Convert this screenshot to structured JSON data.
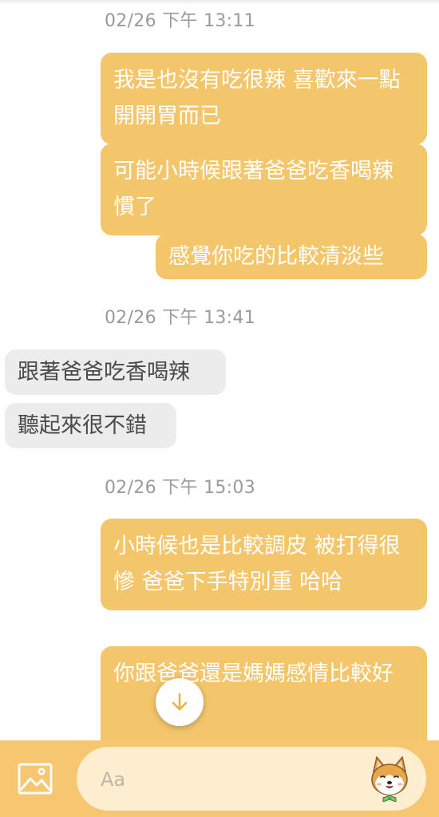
{
  "messages": [
    {
      "type": "timestamp",
      "text": "02/26 下午 13:11"
    },
    {
      "type": "outgoing",
      "text": "我是也沒有吃很辣 喜歡來一點開開胃而已"
    },
    {
      "type": "outgoing",
      "text": "可能小時候跟著爸爸吃香喝辣慣了"
    },
    {
      "type": "outgoing",
      "text": "感覺你吃的比較清淡些"
    },
    {
      "type": "timestamp",
      "text": "02/26 下午 13:41"
    },
    {
      "type": "incoming",
      "text": "跟著爸爸吃香喝辣"
    },
    {
      "type": "incoming",
      "text": "聽起來很不錯"
    },
    {
      "type": "timestamp",
      "text": "02/26 下午 15:03"
    },
    {
      "type": "outgoing",
      "text": "小時候也是比較調皮 被打得很慘 爸爸下手特別重 哈哈"
    },
    {
      "type": "outgoing",
      "text": "你跟爸爸還是媽媽感情比較好"
    }
  ],
  "composer": {
    "placeholder": "Aa",
    "image_icon": "image-icon",
    "sticker_icon": "shiba-sticker-icon"
  },
  "scroll_button": {
    "icon": "arrow-down-icon"
  },
  "colors": {
    "outgoing_bubble": "#f4c66c",
    "incoming_bubble": "#ececec",
    "composer_bar": "#f6c670",
    "input_pill": "#fdeed0"
  }
}
